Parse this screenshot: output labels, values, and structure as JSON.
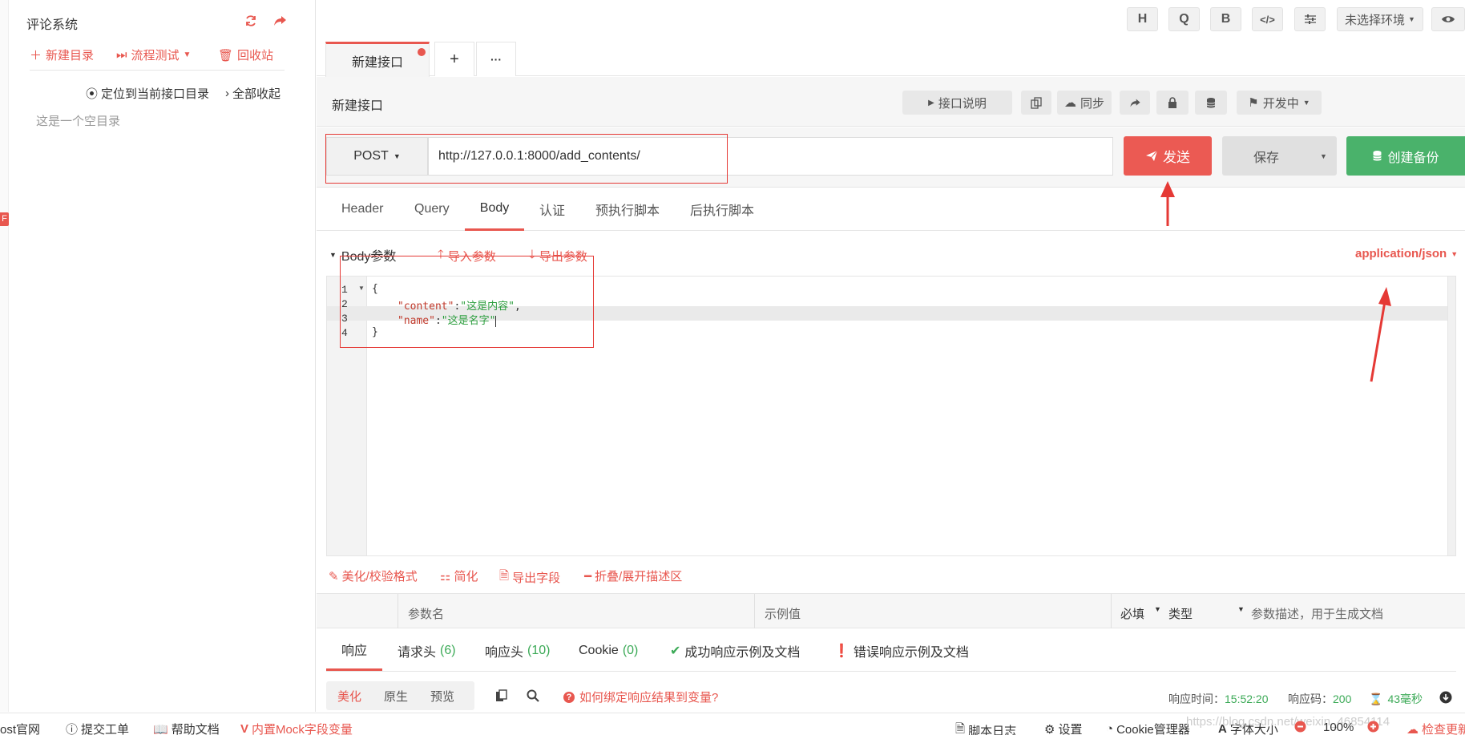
{
  "sidebar": {
    "title": "评论系统",
    "tools": {
      "new_dir": "新建目录",
      "flow_test": "流程测试",
      "recycle": "回收站"
    },
    "locate": "定位到当前接口目录",
    "collapse_all": "全部收起",
    "empty_text": "这是一个空目录",
    "badge": "F"
  },
  "topbar": {
    "btn_h": "H",
    "btn_q": "Q",
    "btn_b": "B",
    "env": "未选择环境"
  },
  "tabs": {
    "active_label": "新建接口",
    "add": "+",
    "more": "···"
  },
  "interface": {
    "name": "新建接口",
    "doc_btn": "接口说明",
    "sync_btn": "同步",
    "status_btn": "开发中"
  },
  "request": {
    "method": "POST",
    "url": "http://127.0.0.1:8000/add_contents/",
    "send": "发送",
    "save": "保存",
    "backup": "创建备份",
    "tabs": [
      "Header",
      "Query",
      "Body",
      "认证",
      "预执行脚本",
      "后执行脚本"
    ],
    "active_tab": "Body"
  },
  "body": {
    "label": "Body参数",
    "import": "导入参数",
    "export": "导出参数",
    "content_type": "application/json",
    "code_lines": [
      {
        "num": "1",
        "open": "{"
      },
      {
        "num": "2",
        "key": "\"content\"",
        "colon": ":",
        "value": "\"这是内容\"",
        "tail": ","
      },
      {
        "num": "3",
        "key": "\"name\"",
        "colon": ":",
        "value": "\"这是名字\"",
        "tail": ""
      },
      {
        "num": "4",
        "open": "}"
      }
    ],
    "tools": {
      "beautify": "美化/校验格式",
      "simplify": "简化",
      "export_fields": "导出字段",
      "fold": "折叠/展开描述区"
    }
  },
  "params_table": {
    "headers": {
      "name": "参数名",
      "example": "示例值",
      "required": "必填",
      "type": "类型",
      "desc": "参数描述，用于生成文档"
    }
  },
  "response": {
    "tabs": {
      "resp": "响应",
      "req_headers": "请求头",
      "req_headers_count": "(6)",
      "resp_headers": "响应头",
      "resp_headers_count": "(10)",
      "cookie": "Cookie",
      "cookie_count": "(0)",
      "success": "成功响应示例及文档",
      "error": "错误响应示例及文档"
    },
    "view_modes": [
      "美化",
      "原生",
      "预览"
    ],
    "bind_question": "如何绑定响应结果到变量?",
    "time_label": "响应时间：",
    "time_value": "15:52:20",
    "code_label": "响应码：",
    "code_value": "200",
    "duration": "43毫秒"
  },
  "statusbar": {
    "official": "ost官网",
    "ticket": "提交工单",
    "help": "帮助文档",
    "mock": "内置Mock字段变量",
    "script_log": "脚本日志",
    "settings": "设置",
    "cookie_mgr": "Cookie管理器",
    "font_size": "字体大小",
    "zoom": "100%",
    "check_update": "检查更新"
  },
  "watermark": "https://blog.csdn.net/weixin_46854114",
  "colors": {
    "accent": "#e8574f",
    "success": "#4ab26b",
    "send": "#eb5a53"
  }
}
